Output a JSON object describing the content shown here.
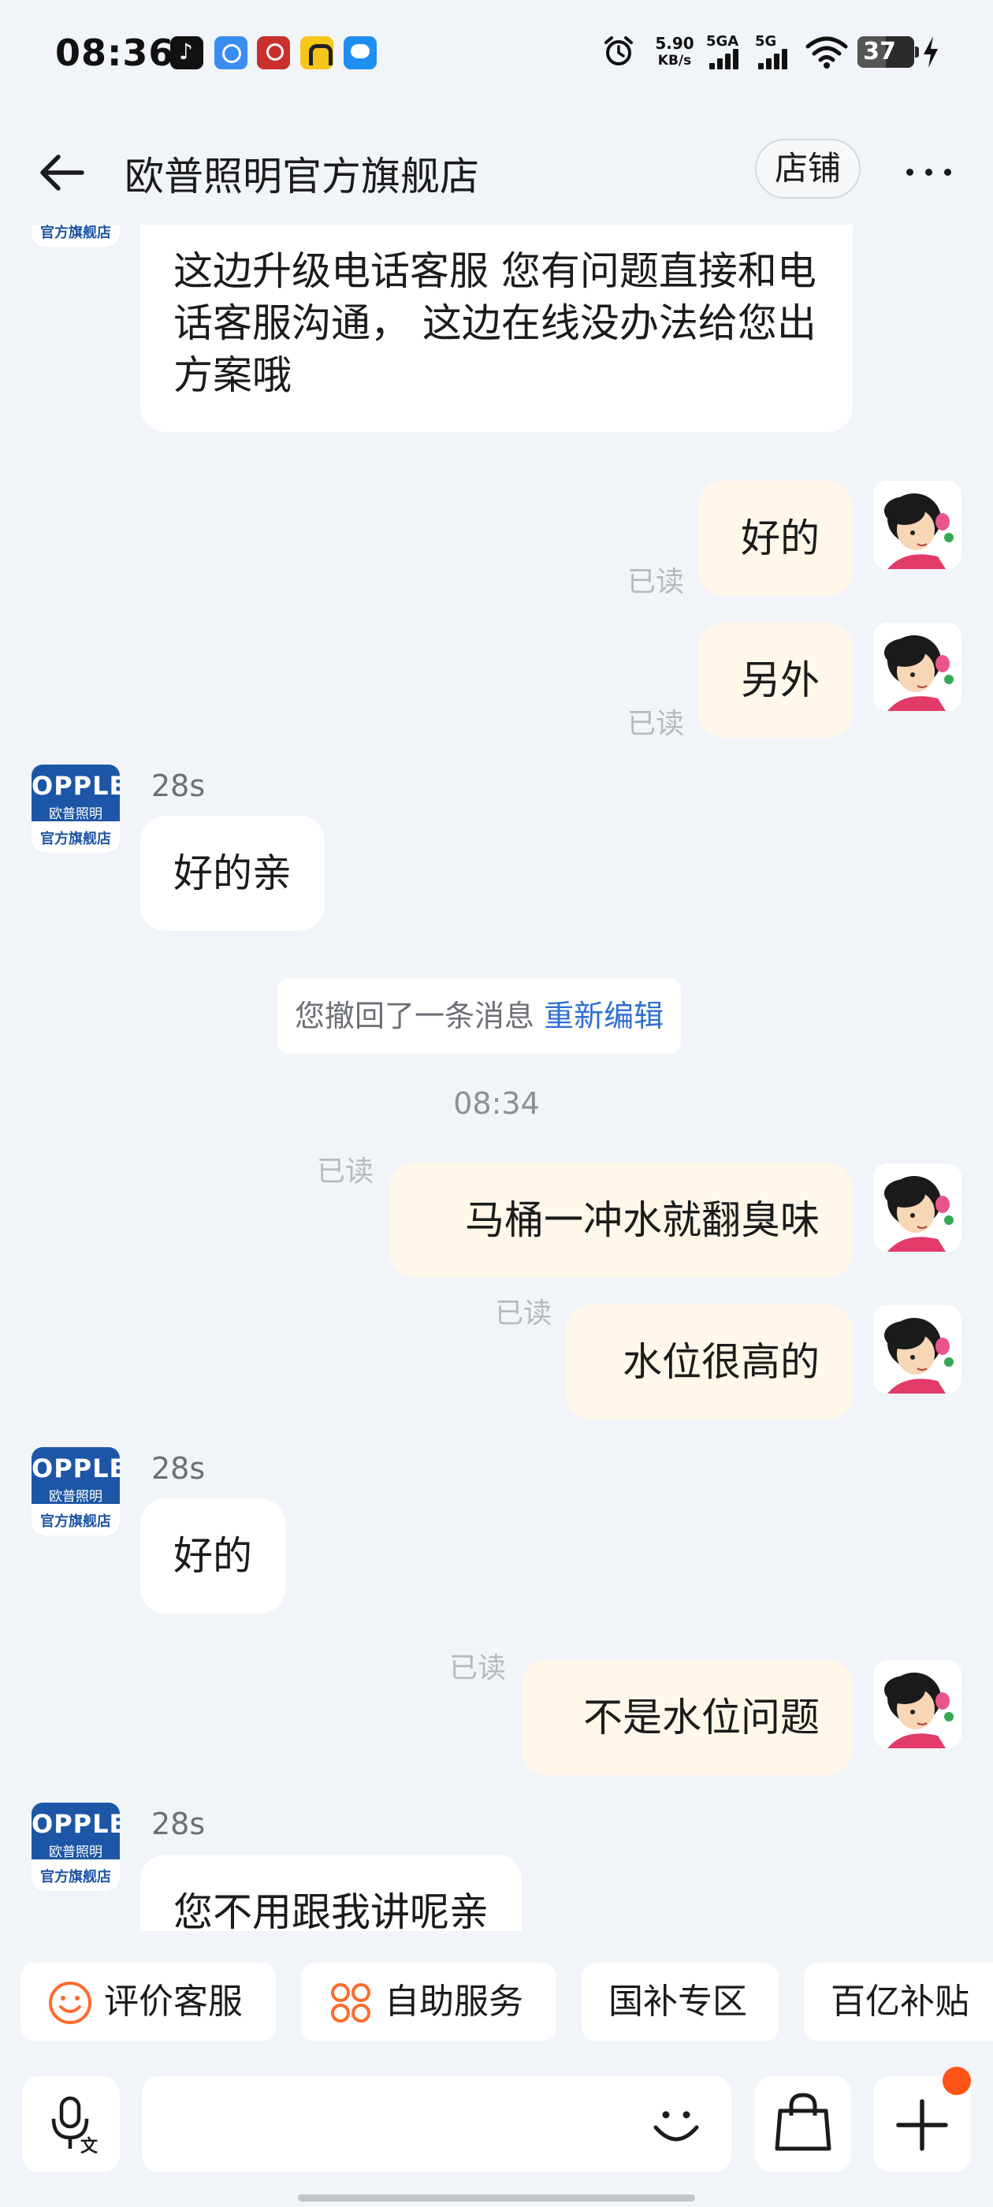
{
  "status_bar": {
    "time": "08:36",
    "net_speed_value": "5.90",
    "net_speed_unit": "KB/s",
    "network_1": "5GA",
    "network_2": "5G",
    "battery": "37",
    "icons": [
      "tiktok-icon",
      "app-blue-icon",
      "app-red-icon",
      "app-yellow-icon",
      "app-blue-robot-icon",
      "alarm-icon",
      "signal-icon",
      "wifi-icon",
      "battery-icon",
      "charging-icon"
    ]
  },
  "header": {
    "title": "欧普照明官方旗舰店",
    "shop_button": "店铺",
    "back_icon": "arrow-left-icon",
    "more_icon": "more-dots-icon"
  },
  "shop_avatar": {
    "logo": "OPPLE",
    "line1": "欧普照明",
    "line2": "官方旗舰店",
    "color": "#1d56a6"
  },
  "messages": {
    "m1": {
      "sender": "shop",
      "text": "这边升级电话客服 您有问题直接和电话客服沟通， 这边在线没办法给您出方案哦"
    },
    "m2": {
      "sender": "user",
      "text": "好的",
      "status": "已读"
    },
    "m3": {
      "sender": "user",
      "text": "另外",
      "status": "已读"
    },
    "m4": {
      "sender": "shop",
      "time": "28s",
      "text": "好的亲"
    },
    "sys1": {
      "text": "您撤回了一条消息",
      "action": "重新编辑"
    },
    "t1": {
      "text": "08:34"
    },
    "m5": {
      "sender": "user",
      "text": "马桶一冲水就翻臭味",
      "status": "已读"
    },
    "m6": {
      "sender": "user",
      "text": "水位很高的",
      "status": "已读"
    },
    "m7": {
      "sender": "shop",
      "time": "28s",
      "text": "好的"
    },
    "m8": {
      "sender": "user",
      "text": "不是水位问题",
      "status": "已读"
    },
    "m9": {
      "sender": "shop",
      "time": "28s",
      "text": "您不用跟我讲呢亲"
    }
  },
  "quick_actions": [
    {
      "label": "评价客服",
      "icon": "smiley-icon"
    },
    {
      "label": "自助服务",
      "icon": "grid-circles-icon"
    },
    {
      "label": "国补专区"
    },
    {
      "label": "百亿补贴"
    }
  ],
  "input_bar": {
    "voice_icon": "mic-translate-icon",
    "emoji_icon": "emoji-icon",
    "cart_icon": "shopping-bag-icon",
    "plus_icon": "plus-icon"
  },
  "colors": {
    "background": "#f1f4f8",
    "outgoing_bubble": "#fff7ea",
    "incoming_bubble": "#ffffff",
    "link": "#2f6ed1",
    "accent_orange": "#ff5317",
    "brand_blue": "#1d56a6"
  }
}
